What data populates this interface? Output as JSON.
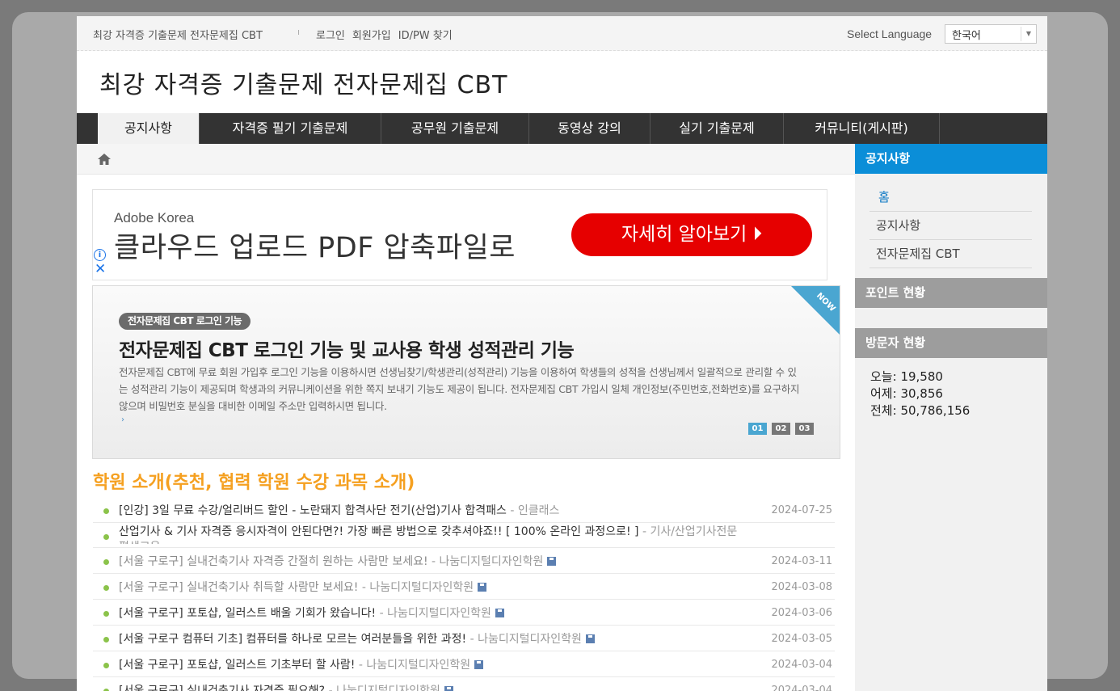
{
  "topbar": {
    "brand": "최강 자격증 기출문제 전자문제집 CBT",
    "separator": "ı",
    "links": [
      "로그인",
      "회원가입",
      "ID/PW 찾기"
    ],
    "language_label": "Select Language",
    "language_value": "한국어"
  },
  "logo": {
    "text": "최강 자격증 기출문제 전자문제집 CBT"
  },
  "nav": {
    "items": [
      "공지사항",
      "자격증 필기 기출문제",
      "공무원 기출문제",
      "동영상 강의",
      "실기 기출문제",
      "커뮤니티(게시판)"
    ],
    "active_index": 0
  },
  "ad": {
    "brand": "Adobe Korea",
    "headline": "클라우드 업로드 PDF 압축파일로",
    "cta": "자세히 알아보기 ⏵",
    "info_symbol": "i",
    "close_symbol": "✕"
  },
  "slide": {
    "badge": "전자문제집 CBT 로그인 기능",
    "title": "전자문제집 CBT 로그인 기능 및 교사용 학생 성적관리 기능",
    "description": "전자문제집 CBT에 무료 회원 가입후 로그인 기능을 이용하시면 선생님찾기/학생관리(성적관리) 기능을 이용하여 학생들의 성적을 선생님께서 일괄적으로 관리할 수 있는 성적관리 기능이 제공되며 학생과의 커뮤니케이션을 위한 쪽지 보내기 기능도 제공이 됩니다. 전자문제집 CBT 가입시 일체 개인정보(주민번호,전화번호)를 요구하지 않으며 비밀번호 분실을 대비한 이메일 주소만 입력하시면 됩니다.",
    "more_symbol": "›",
    "corner_text": "NOW",
    "pager": [
      "01",
      "02",
      "03"
    ],
    "pager_active": 0
  },
  "list": {
    "title": "학원 소개(추천, 협력 학원 수강 과목 소개)",
    "rows": [
      {
        "text": "[인강] 3일 무료 수강/얼리버드 할인 - 노란돼지 합격사단 전기(산업)기사 합격패스",
        "source": "- 인클래스",
        "date": "2024-07-25",
        "disk": false,
        "muted": false
      },
      {
        "text": "산업기사 & 기사 자격증 응시자격이 안된다면?! 가장 빠른 방법으로 갖추셔야죠!! [ 100% 온라인 과정으로! ]",
        "source": "- 기사/산업기사전문평생교육",
        "date": "",
        "disk": false,
        "muted": false
      },
      {
        "text": "[서울 구로구] 실내건축기사 자격증 간절히 원하는 사람만 보세요!",
        "source": "- 나눔디지털디자인학원",
        "date": "2024-03-11",
        "disk": true,
        "muted": true
      },
      {
        "text": "[서울 구로구] 실내건축기사 취득할 사람만 보세요!",
        "source": "- 나눔디지털디자인학원",
        "date": "2024-03-08",
        "disk": true,
        "muted": true
      },
      {
        "text": "[서울 구로구] 포토샵, 일러스트 배울 기회가 왔습니다!",
        "source": "- 나눔디지털디자인학원",
        "date": "2024-03-06",
        "disk": true,
        "muted": false
      },
      {
        "text": "[서울 구로구 컴퓨터 기초] 컴퓨터를 하나로 모르는 여러분들을 위한 과정!",
        "source": "- 나눔디지털디자인학원",
        "date": "2024-03-05",
        "disk": true,
        "muted": false
      },
      {
        "text": "[서울 구로구] 포토샵, 일러스트 기초부터 할 사람!",
        "source": "- 나눔디지털디자인학원",
        "date": "2024-03-04",
        "disk": true,
        "muted": false
      },
      {
        "text": "[서울 구로구] 실내건축기사 자격증 필요해?",
        "source": "- 나눔디지털디자인학원",
        "date": "2024-03-04",
        "disk": true,
        "muted": false
      }
    ]
  },
  "sidebar": {
    "section1_title": "공지사항",
    "menu": [
      "홈",
      "공지사항",
      "전자문제집 CBT"
    ],
    "section2_title": "포인트 현황",
    "section3_title": "방문자 현황",
    "visitors": {
      "today_label": "오늘:",
      "today": "19,580",
      "yesterday_label": "어제:",
      "yesterday": "30,856",
      "total_label": "전체:",
      "total": "50,786,156"
    }
  },
  "colors": {
    "accent_blue": "#0b8ed8",
    "list_title": "#f5a020",
    "ad_cta": "#e60000",
    "nav_bg": "#333333"
  }
}
